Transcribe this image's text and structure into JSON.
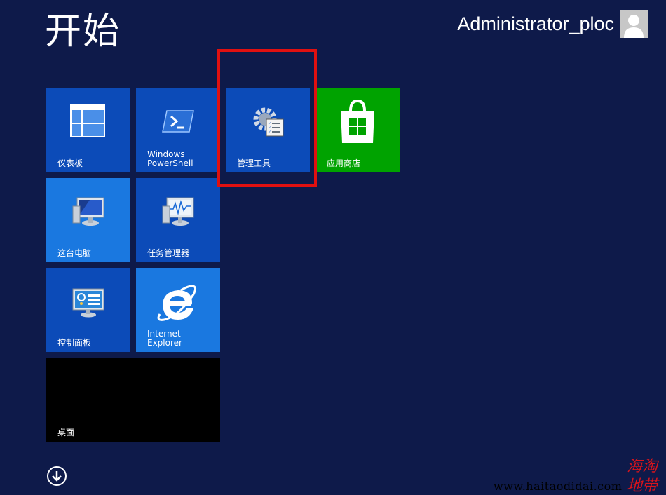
{
  "header": {
    "title": "开始",
    "user_name": "Administrator_ploc"
  },
  "tiles": {
    "dashboard": "仪表板",
    "powershell": "Windows\nPowerShell",
    "admin_tools": "管理工具",
    "store": "应用商店",
    "this_pc": "这台电脑",
    "task_manager": "任务管理器",
    "control_panel": "控制面板",
    "ie": "Internet\nExplorer",
    "desktop": "桌面"
  },
  "watermark": {
    "url": "www.haitaodidai.com",
    "logo_text": "海淘地带"
  },
  "colors": {
    "background": "#0e1a4a",
    "tile_dark": "#0c4bb8",
    "tile_light": "#1a78e0",
    "tile_green": "#00a300",
    "highlight": "#e01010"
  }
}
